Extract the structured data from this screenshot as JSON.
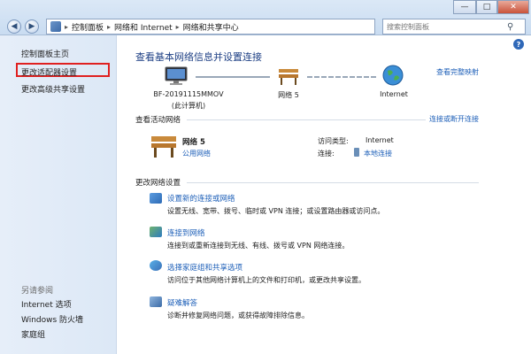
{
  "address": {
    "crumbs": [
      "控制面板",
      "网络和 Internet",
      "网络和共享中心"
    ],
    "separator": "▸"
  },
  "search": {
    "placeholder": "搜索控制面板"
  },
  "window_buttons": {
    "minimize": "—",
    "maximize": "□",
    "close": "✕"
  },
  "nav": {
    "back": "◀",
    "forward": "▶"
  },
  "sidebar": {
    "home": "控制面板主页",
    "adapter_settings": "更改适配器设置",
    "advanced_sharing": "更改高级共享设置",
    "see_also_label": "另请参阅",
    "see_also": [
      "Internet 选项",
      "Windows 防火墙",
      "家庭组"
    ]
  },
  "main": {
    "help": "?",
    "title": "查看基本网络信息并设置连接",
    "view_full_map": "查看完整映射",
    "map": {
      "computer_name": "BF-20191115MMOV",
      "computer_sub": "(此计算机)",
      "network_name": "网络  5",
      "internet": "Internet"
    },
    "active_networks_label": "查看活动网络",
    "connect_disconnect": "连接或断开连接",
    "network": {
      "name": "网络  5",
      "type": "公用网络",
      "access_label": "访问类型:",
      "access_value": "Internet",
      "connection_label": "连接:",
      "connection_value": "本地连接"
    },
    "change_settings_label": "更改网络设置",
    "tasks": [
      {
        "title": "设置新的连接或网络",
        "desc": "设置无线、宽带、拨号、临时或 VPN 连接；或设置路由器或访问点。",
        "icon": "new-connection-icon"
      },
      {
        "title": "连接到网络",
        "desc": "连接到或重新连接到无线、有线、拨号或 VPN 网络连接。",
        "icon": "connect-network-icon"
      },
      {
        "title": "选择家庭组和共享选项",
        "desc": "访问位于其他网络计算机上的文件和打印机，或更改共享设置。",
        "icon": "homegroup-icon"
      },
      {
        "title": "疑难解答",
        "desc": "诊断并修复网络问题，或获得故障排除信息。",
        "icon": "troubleshoot-icon"
      }
    ]
  },
  "colors": {
    "link": "#1d5fb8",
    "title": "#1d3f84",
    "sidebar": "#dce8f6",
    "highlight": "#e02020"
  }
}
